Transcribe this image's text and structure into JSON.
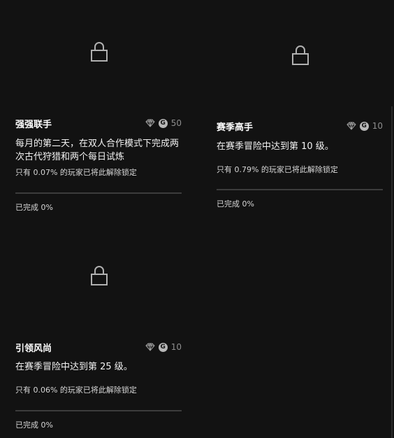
{
  "achievements": [
    {
      "title": "强强联手",
      "description": "每月的第二天，在双人合作模式下完成两次古代狩猎和两个每日试炼",
      "gamerscore": "50",
      "rarity_text": "只有 0.07% 的玩家已将此解除锁定",
      "progress_text": "已完成 0%",
      "progress_fraction": 0,
      "icon_name": "lock-icon"
    },
    {
      "title": "赛季高手",
      "description": "在赛季冒险中达到第 10 级。",
      "gamerscore": "10",
      "rarity_text": "只有 0.79% 的玩家已将此解除锁定",
      "progress_text": "已完成 0%",
      "progress_fraction": 0,
      "icon_name": "lock-icon"
    },
    {
      "title": "引领风尚",
      "description": "在赛季冒险中达到第 25 级。",
      "gamerscore": "10",
      "rarity_text": "只有 0.06% 的玩家已将此解除锁定",
      "progress_text": "已完成 0%",
      "progress_fraction": 0,
      "icon_name": "lock-icon"
    }
  ],
  "badge": {
    "g_letter": "G",
    "gem_icon": "diamond-icon"
  },
  "colors": {
    "background": "#121212",
    "text": "#ffffff",
    "muted": "#8e8e8e",
    "track": "#3c3c3c"
  }
}
